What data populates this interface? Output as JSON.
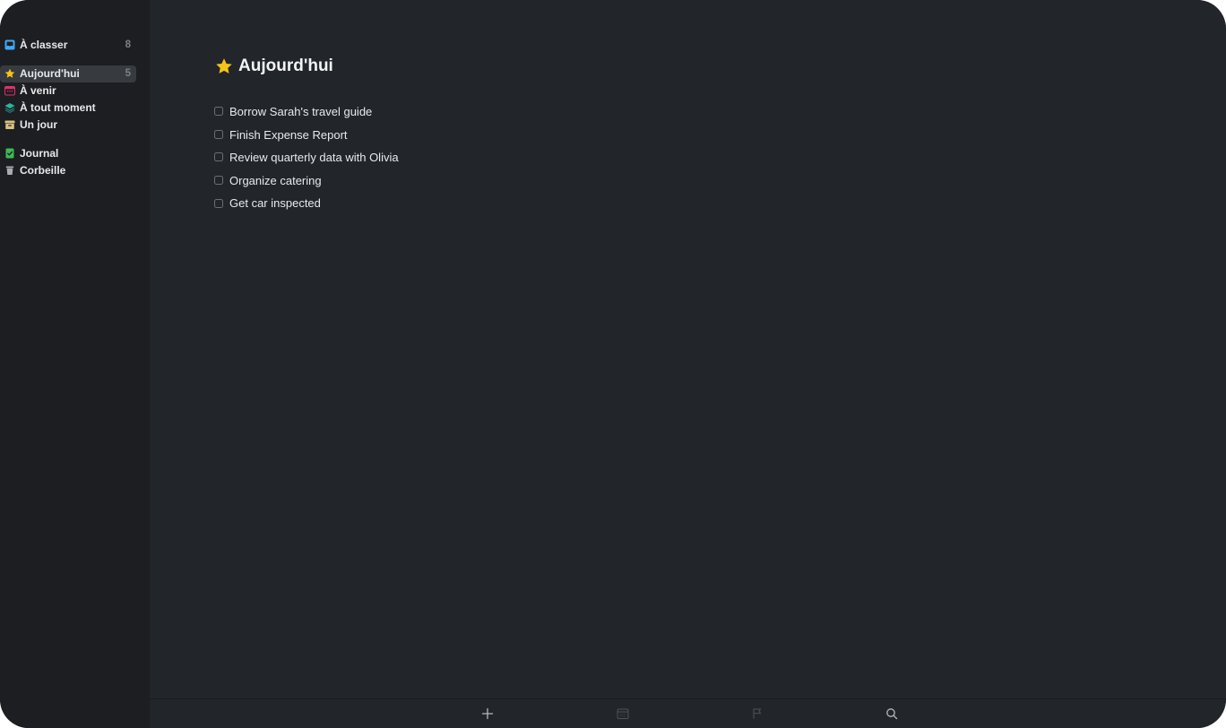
{
  "sidebar": {
    "inbox": {
      "label": "À classer",
      "count": "8",
      "icon": "inbox-tray-icon",
      "color": "#3fa9f5"
    },
    "items": [
      {
        "label": "Aujourd'hui",
        "count": "5",
        "icon": "star-icon",
        "color": "#f5c518",
        "active": true
      },
      {
        "label": "À venir",
        "count": "",
        "icon": "calendar-icon",
        "color": "#e0306a"
      },
      {
        "label": "À tout moment",
        "count": "",
        "icon": "layers-icon",
        "color": "#2bb5a0"
      },
      {
        "label": "Un jour",
        "count": "",
        "icon": "archive-box-icon",
        "color": "#d8c080"
      }
    ],
    "bottom_items": [
      {
        "label": "Journal",
        "icon": "logbook-check-icon",
        "color": "#3cba54"
      },
      {
        "label": "Corbeille",
        "icon": "trash-icon",
        "color": "#a8acb2"
      }
    ]
  },
  "main": {
    "title": "Aujourd'hui",
    "title_icon": "star-icon",
    "tasks": [
      {
        "label": "Borrow Sarah's travel guide",
        "checked": false
      },
      {
        "label": "Finish Expense Report",
        "checked": false
      },
      {
        "label": "Review quarterly data with Olivia",
        "checked": false
      },
      {
        "label": "Organize catering",
        "checked": false
      },
      {
        "label": "Get car inspected",
        "checked": false
      }
    ]
  },
  "toolbar": {
    "buttons": [
      "plus-icon",
      "calendar-icon",
      "flag-icon",
      "search-icon"
    ]
  },
  "colors": {
    "sidebar_bg": "#1c1e21",
    "main_bg": "#22252a",
    "active_item_bg": "#373b40",
    "star": "#f5c518"
  }
}
